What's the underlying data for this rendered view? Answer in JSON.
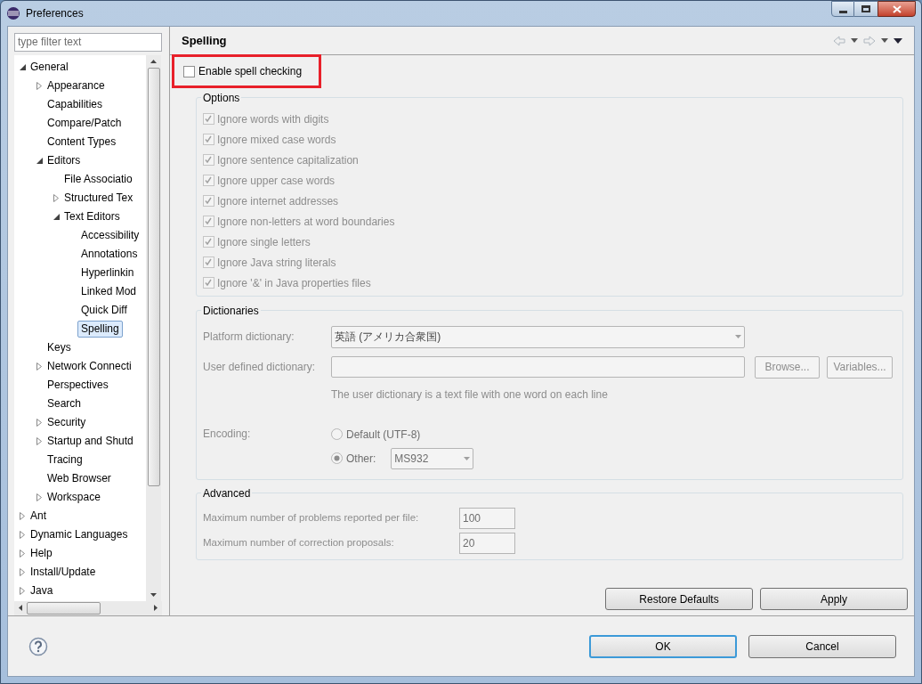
{
  "window": {
    "title": "Preferences"
  },
  "filter": {
    "placeholder": "type filter text"
  },
  "tree": [
    {
      "label": "General",
      "expanded": true,
      "selected": false,
      "children": [
        {
          "label": "Appearance",
          "expanded": false,
          "selected": false
        },
        {
          "label": "Capabilities",
          "selected": false
        },
        {
          "label": "Compare/Patch",
          "selected": false
        },
        {
          "label": "Content Types",
          "selected": false
        },
        {
          "label": "Editors",
          "expanded": true,
          "selected": false,
          "children": [
            {
              "label": "File Associatio",
              "selected": false
            },
            {
              "label": "Structured Tex",
              "expanded": false,
              "selected": false
            },
            {
              "label": "Text Editors",
              "expanded": true,
              "selected": false,
              "children": [
                {
                  "label": "Accessibility",
                  "selected": false
                },
                {
                  "label": "Annotations",
                  "selected": false
                },
                {
                  "label": "Hyperlinkin",
                  "selected": false
                },
                {
                  "label": "Linked Mod",
                  "selected": false
                },
                {
                  "label": "Quick Diff",
                  "selected": false
                },
                {
                  "label": "Spelling",
                  "selected": true
                }
              ]
            }
          ]
        },
        {
          "label": "Keys",
          "selected": false
        },
        {
          "label": "Network Connecti",
          "expanded": false,
          "selected": false
        },
        {
          "label": "Perspectives",
          "selected": false
        },
        {
          "label": "Search",
          "selected": false
        },
        {
          "label": "Security",
          "expanded": false,
          "selected": false
        },
        {
          "label": "Startup and Shutd",
          "expanded": false,
          "selected": false
        },
        {
          "label": "Tracing",
          "selected": false
        },
        {
          "label": "Web Browser",
          "selected": false
        },
        {
          "label": "Workspace",
          "expanded": false,
          "selected": false
        }
      ]
    },
    {
      "label": "Ant",
      "expanded": false,
      "selected": false
    },
    {
      "label": "Dynamic Languages",
      "expanded": false,
      "selected": false
    },
    {
      "label": "Help",
      "expanded": false,
      "selected": false
    },
    {
      "label": "Install/Update",
      "expanded": false,
      "selected": false
    },
    {
      "label": "Java",
      "expanded": false,
      "selected": false
    }
  ],
  "page": {
    "title": "Spelling",
    "enable": {
      "label": "Enable spell checking",
      "checked": false,
      "highlighted": true
    },
    "options": {
      "title": "Options",
      "disabled": true,
      "items": [
        {
          "label": "Ignore words with digits",
          "checked": true
        },
        {
          "label": "Ignore mixed case words",
          "checked": true
        },
        {
          "label": "Ignore sentence capitalization",
          "checked": true
        },
        {
          "label": "Ignore upper case words",
          "checked": true
        },
        {
          "label": "Ignore internet addresses",
          "checked": true
        },
        {
          "label": "Ignore non-letters at word boundaries",
          "checked": true
        },
        {
          "label": "Ignore single letters",
          "checked": true
        },
        {
          "label": "Ignore Java string literals",
          "checked": true
        },
        {
          "label": "Ignore '&' in Java properties files",
          "checked": true
        }
      ]
    },
    "dictionaries": {
      "title": "Dictionaries",
      "platform_label": "Platform dictionary:",
      "platform_value": "英語 (アメリカ合衆国)",
      "user_label": "User defined dictionary:",
      "browse": "Browse...",
      "variables": "Variables...",
      "hint": "The user dictionary is a text file with one word on each line",
      "encoding_label": "Encoding:",
      "encodings": [
        {
          "label": "Default (UTF-8)",
          "selected": false
        },
        {
          "label": "Other:",
          "selected": true
        }
      ],
      "other_value": "MS932"
    },
    "advanced": {
      "title": "Advanced",
      "fields": [
        {
          "label": "Maximum number of problems reported per file:",
          "value": "100"
        },
        {
          "label": "Maximum number of correction proposals:",
          "value": "20"
        }
      ]
    },
    "restore": "Restore Defaults",
    "apply": "Apply"
  },
  "buttons": [
    {
      "label": "OK",
      "default": true
    },
    {
      "label": "Cancel",
      "default": false
    }
  ]
}
